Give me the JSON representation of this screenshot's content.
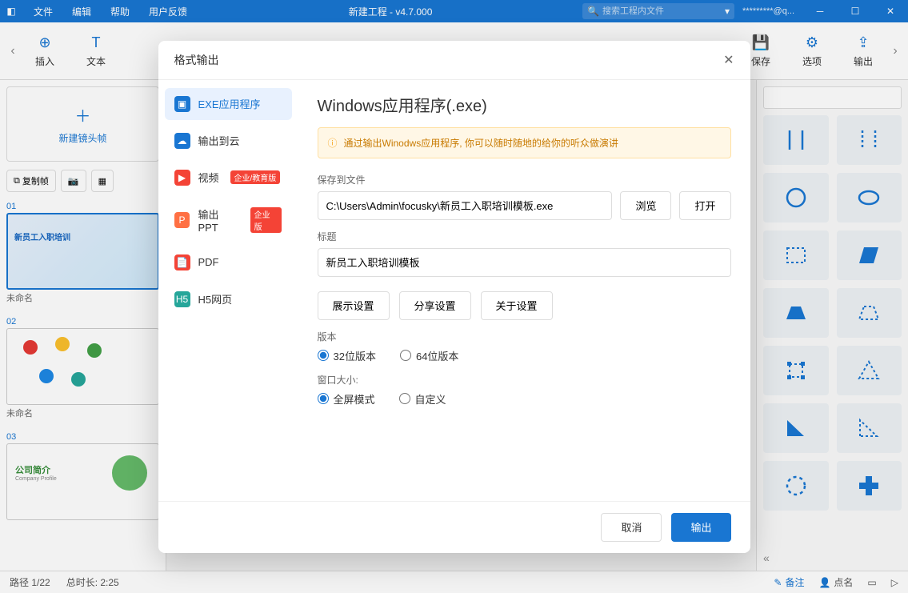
{
  "menu": {
    "file": "文件",
    "edit": "编辑",
    "help": "帮助",
    "feedback": "用户反馈"
  },
  "title": "新建工程 - v4.7.000",
  "search_placeholder": "搜索工程内文件",
  "user": "*********@q...",
  "toolbar": {
    "insert": "插入",
    "text": "文本",
    "save": "保存",
    "options": "选项",
    "output": "输出"
  },
  "left": {
    "newframe": "新建镜头帧",
    "copy": "复制帧",
    "slides": [
      {
        "num": "01",
        "cap": "未命名",
        "label": "新员工入职培训"
      },
      {
        "num": "02",
        "cap": "未命名",
        "label": ""
      },
      {
        "num": "03",
        "cap": "",
        "label": "公司简介",
        "sub": "Company Profile"
      }
    ]
  },
  "status": {
    "path": "路径 1/22",
    "duration": "总时长: 2:25",
    "notes": "备注",
    "click": "点名"
  },
  "dialog": {
    "title": "格式输出",
    "side": [
      {
        "label": "EXE应用程序",
        "color": "#1976d2",
        "active": true
      },
      {
        "label": "输出到云",
        "color": "#1976d2"
      },
      {
        "label": "视频",
        "color": "#f44336",
        "badge": "企业/教育版"
      },
      {
        "label": "输出PPT",
        "color": "#ff7043",
        "badge": "企业版"
      },
      {
        "label": "PDF",
        "color": "#f44336"
      },
      {
        "label": "H5网页",
        "color": "#26a69a"
      }
    ],
    "heading": "Windows应用程序(.exe)",
    "tip": "通过输出Winodws应用程序, 你可以随时随地的给你的听众做演讲",
    "save_label": "保存到文件",
    "save_value": "C:\\Users\\Admin\\focusky\\新员工入职培训模板.exe",
    "browse": "浏览",
    "open": "打开",
    "title_label": "标题",
    "title_value": "新员工入职培训模板",
    "settings": {
      "display": "展示设置",
      "share": "分享设置",
      "about": "关于设置"
    },
    "version_label": "版本",
    "v32": "32位版本",
    "v64": "64位版本",
    "window_label": "窗口大小:",
    "full": "全屏模式",
    "custom": "自定义",
    "cancel": "取消",
    "ok": "输出"
  }
}
